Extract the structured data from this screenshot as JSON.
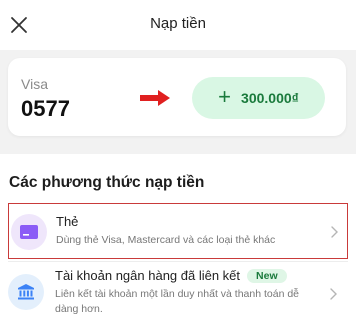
{
  "header": {
    "title": "Nạp tiền",
    "close_icon": "close-icon"
  },
  "card": {
    "type": "Visa",
    "number": "0577"
  },
  "annotation": {
    "arrow_color": "#e02020"
  },
  "amount_button": {
    "plus": "+",
    "label": "300.000₫",
    "bg": "#d9f7e4",
    "text_color": "#1a7a3c"
  },
  "section": {
    "title": "Các phương thức nạp tiền"
  },
  "methods": [
    {
      "title": "Thẻ",
      "description": "Dùng thẻ Visa, Mastercard và các loại thẻ khác",
      "icon": "card-icon",
      "icon_color": "#8b5cf6",
      "highlight_color": "#c93a3a"
    },
    {
      "title": "Tài khoản ngân hàng đã liên kết",
      "badge": "New",
      "description": "Liên kết tài khoản một lần duy nhất và thanh toán dễ dàng hơn.",
      "icon": "bank-icon",
      "icon_color": "#3b82f6"
    }
  ]
}
